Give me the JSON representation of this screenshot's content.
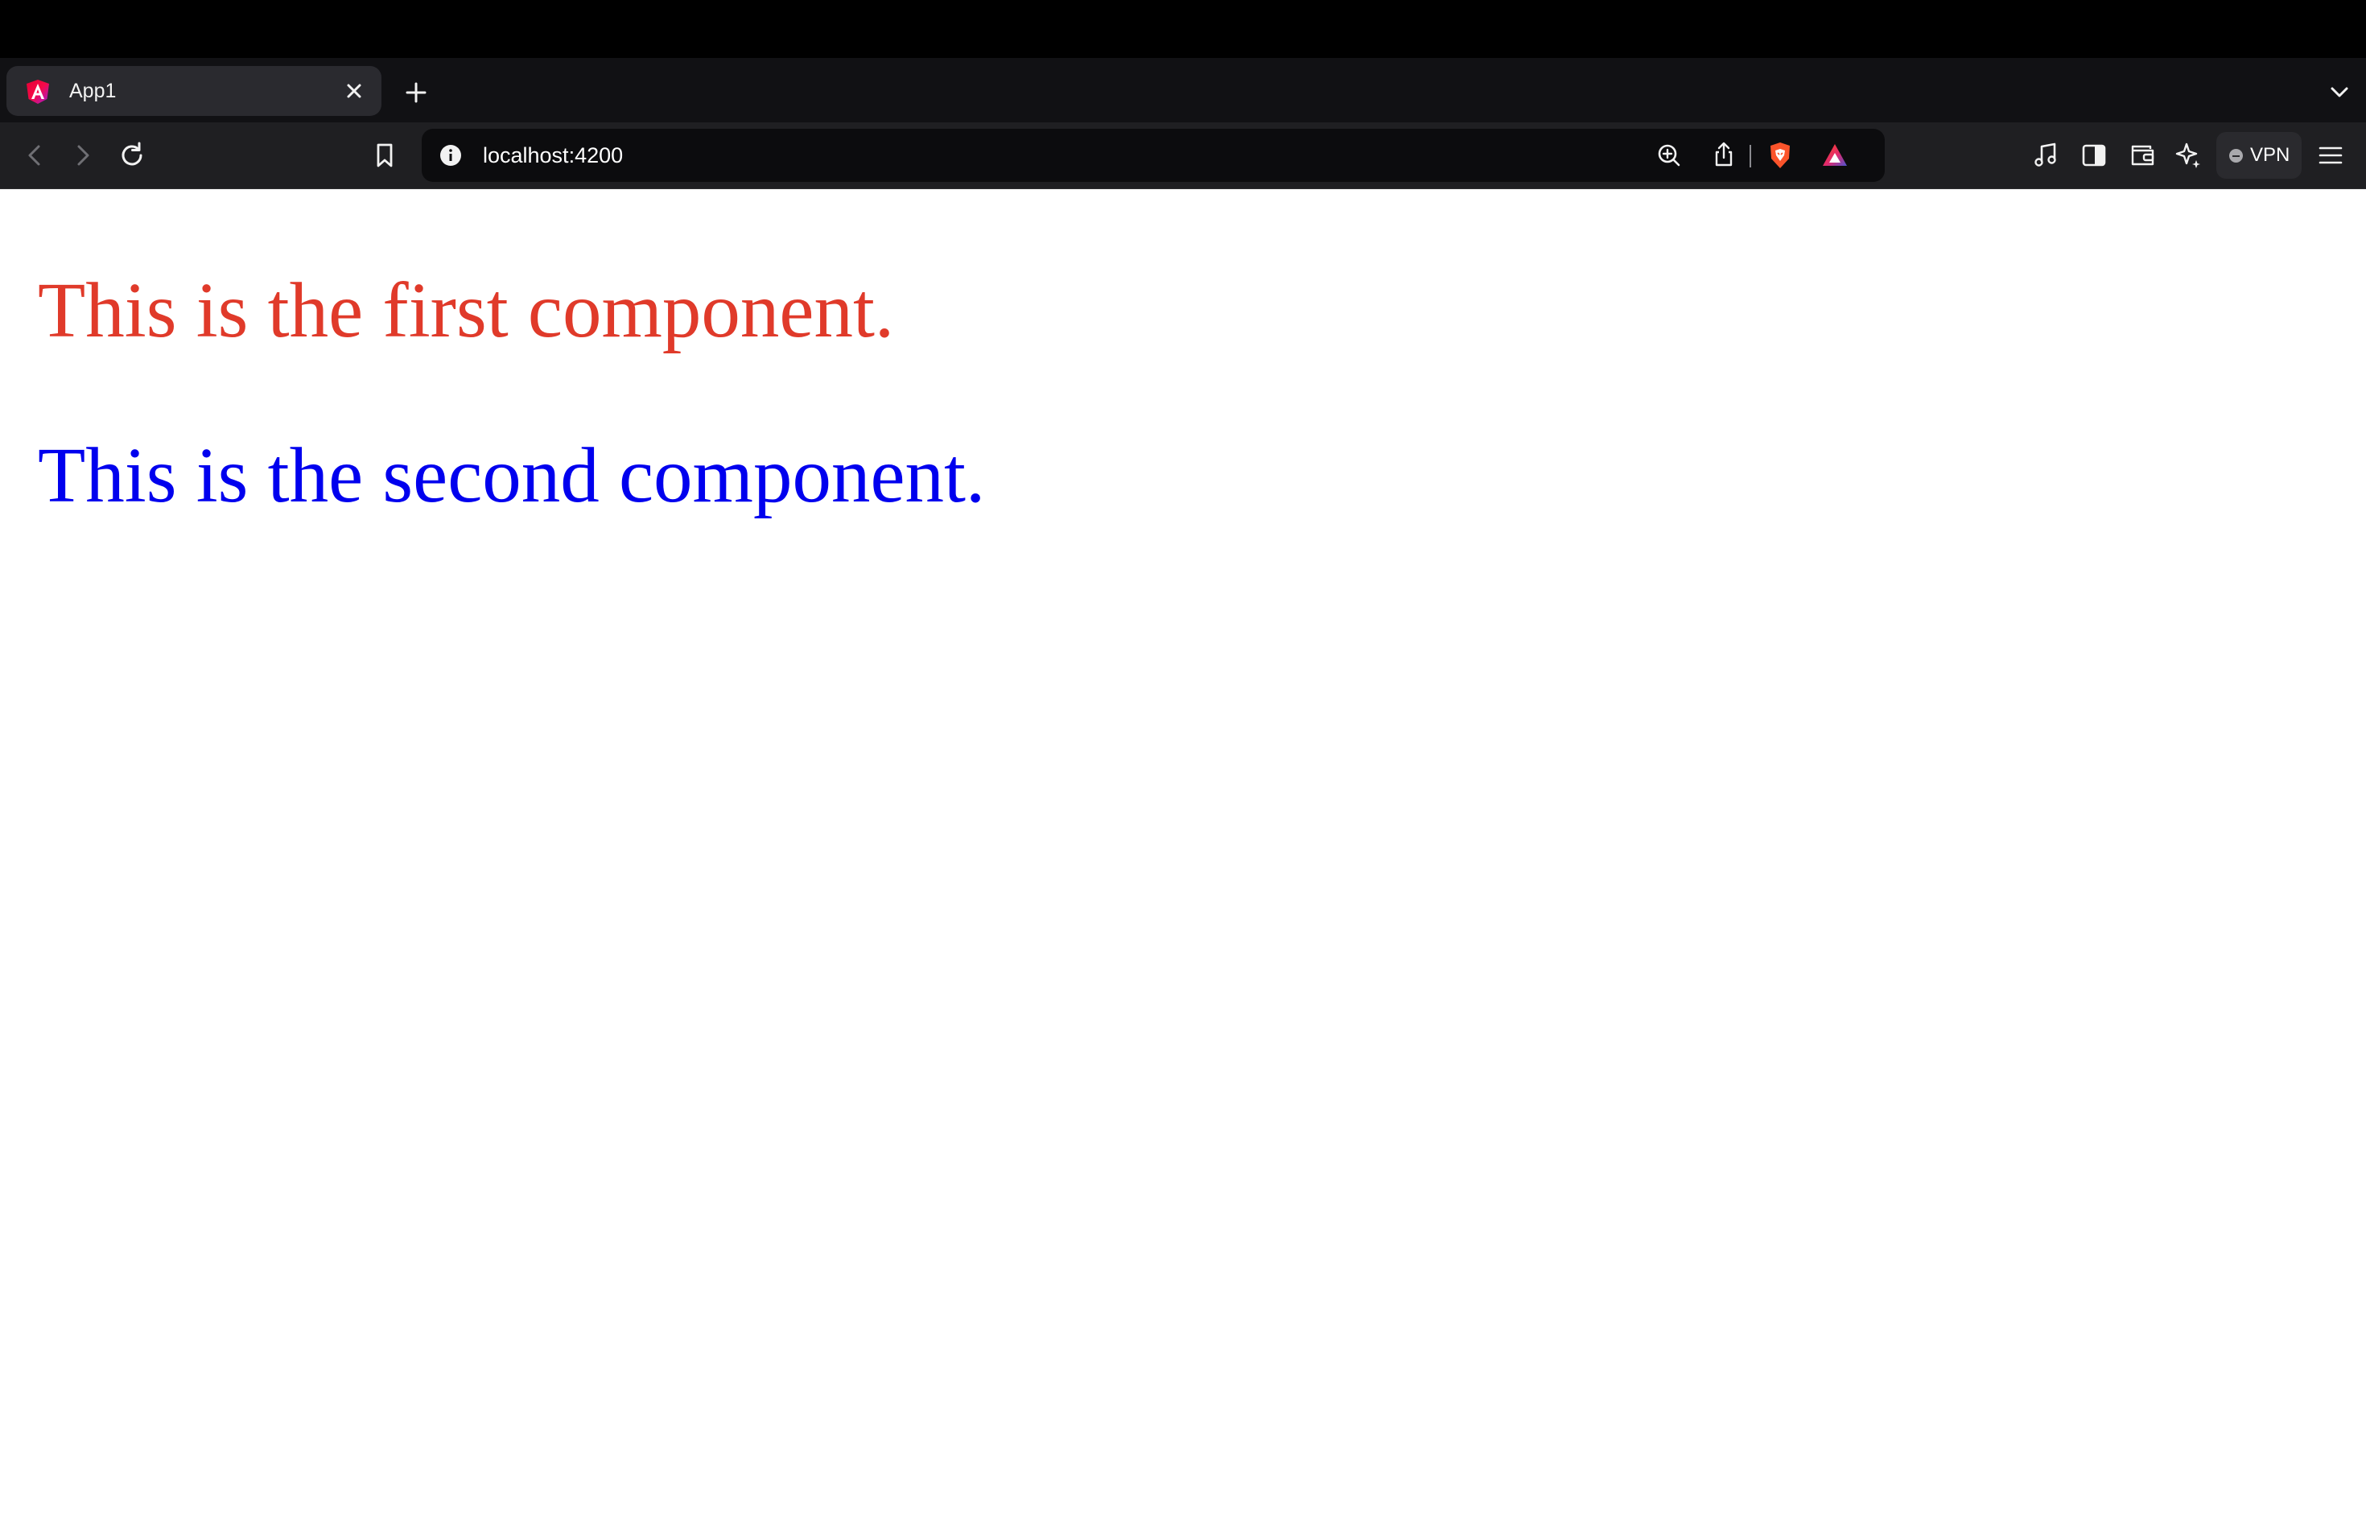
{
  "browser": {
    "tab": {
      "title": "App1",
      "favicon": "angular-logo-icon"
    },
    "toolbar": {
      "back": "back-arrow-icon",
      "forward": "forward-arrow-icon",
      "reload": "reload-icon",
      "bookmark": "bookmark-icon"
    },
    "address_bar": {
      "url": "localhost:4200",
      "site_info": "info-icon",
      "zoom": "zoom-in-icon",
      "share": "share-icon",
      "shields": "brave-shields-icon",
      "rewards": "brave-rewards-icon"
    },
    "extensions": {
      "music": "music-icon",
      "sidebar": "sidebar-icon",
      "wallet": "wallet-icon",
      "leo": "leo-ai-icon",
      "vpn_label": "VPN",
      "menu": "hamburger-menu-icon"
    }
  },
  "page": {
    "first_component": {
      "text": "This is the first component.",
      "color": "#e03a2a"
    },
    "second_component": {
      "text": "This is the second component.",
      "color": "#0000ee"
    }
  },
  "colors": {
    "chrome_bg": "#1f1f22",
    "tabstrip_bg": "#111114",
    "active_tab_bg": "#2a2a2f",
    "urlbar_bg": "#0c0c0e",
    "page_bg": "#ffffff"
  }
}
